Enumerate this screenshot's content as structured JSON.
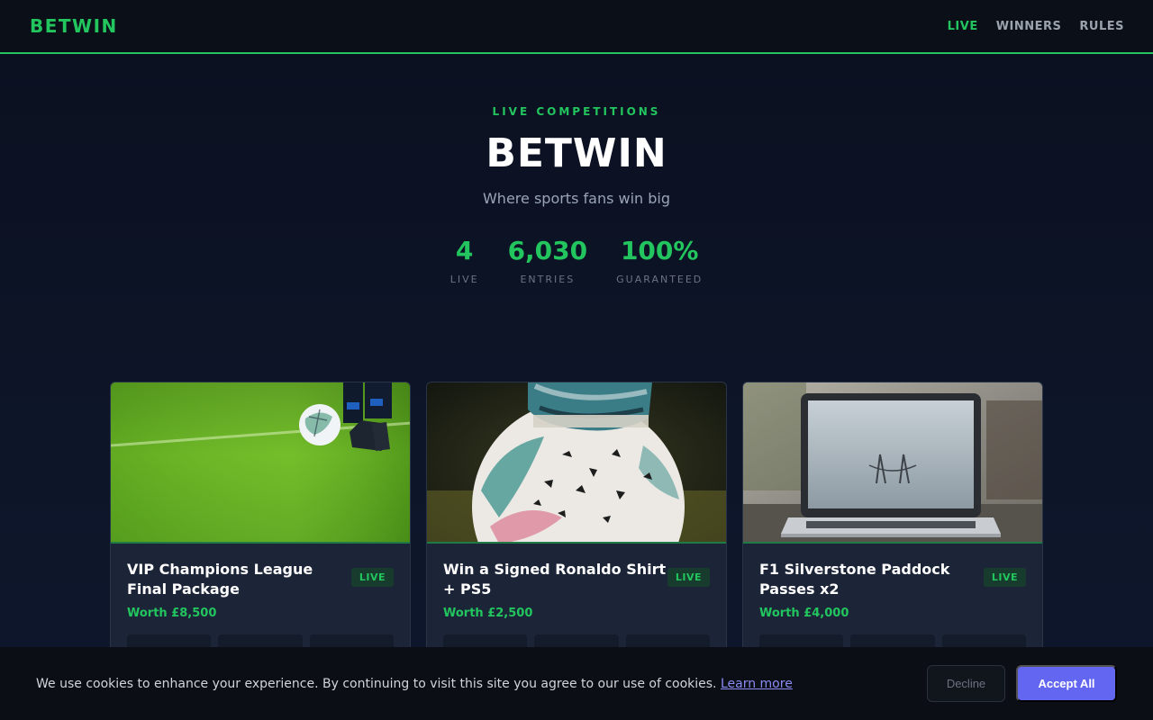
{
  "nav": {
    "brand": "BETWIN",
    "links": [
      {
        "label": "LIVE"
      },
      {
        "label": "WINNERS"
      },
      {
        "label": "RULES"
      }
    ]
  },
  "hero": {
    "kicker": "LIVE COMPETITIONS",
    "title": "BETWIN",
    "tagline": "Where sports fans win big",
    "stats": [
      {
        "value": "4",
        "label": "LIVE"
      },
      {
        "value": "6,030",
        "label": "ENTRIES"
      },
      {
        "value": "100%",
        "label": "GUARANTEED"
      }
    ]
  },
  "competitions": [
    {
      "title": "VIP Champions League Final Package",
      "badge": "LIVE",
      "worth": "Worth £8,500",
      "image": "football-on-pitch"
    },
    {
      "title": "Win a Signed Ronaldo Shirt + PS5",
      "badge": "LIVE",
      "worth": "Worth £2,500",
      "image": "football-under-boot"
    },
    {
      "title": "F1 Silverstone Paddock Passes x2",
      "badge": "LIVE",
      "worth": "Worth £4,000",
      "image": "laptop-on-table"
    }
  ],
  "cookie": {
    "text": "We use cookies to enhance your experience. By continuing to visit this site you agree to our use of cookies.",
    "link": "Learn more",
    "decline": "Decline",
    "accept": "Accept All"
  },
  "colors": {
    "accent": "#22c55e",
    "background": "#0b1020",
    "card": "#1c2538",
    "accept_button": "#6366f1"
  }
}
